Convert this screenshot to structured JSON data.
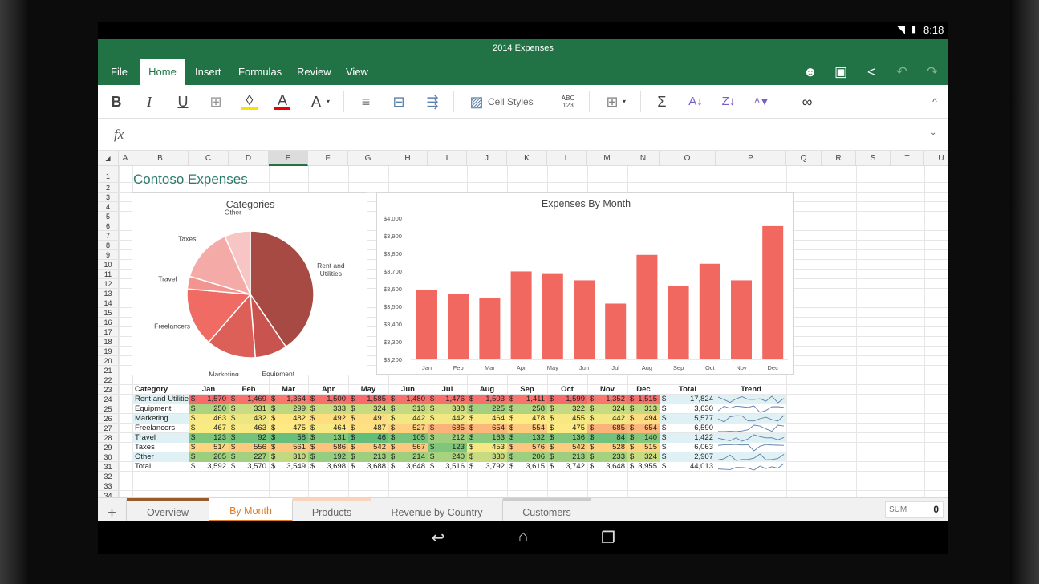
{
  "status": {
    "time": "8:18"
  },
  "title": "2014 Expenses",
  "ribbon_tabs": [
    "File",
    "Home",
    "Insert",
    "Formulas",
    "Review",
    "View"
  ],
  "ribbon_active": "Home",
  "toolbar": {
    "bold": "B",
    "italic": "I",
    "underline": "U",
    "font_color": "A",
    "font_size": "A",
    "cell_styles": "Cell Styles",
    "abc": "ABC",
    "n123": "123",
    "sum": "Σ"
  },
  "formula_bar": {
    "fx": "fx",
    "value": ""
  },
  "columns": [
    "A",
    "B",
    "C",
    "D",
    "E",
    "F",
    "G",
    "H",
    "I",
    "J",
    "K",
    "L",
    "M",
    "N",
    "O",
    "P",
    "Q",
    "R",
    "S",
    "T",
    "U"
  ],
  "selected_column": "E",
  "sheet_title": "Contoso Expenses",
  "table": {
    "header": [
      "Category",
      "Jan",
      "Feb",
      "Mar",
      "Apr",
      "May",
      "Jun",
      "Jul",
      "Aug",
      "Sep",
      "Oct",
      "Nov",
      "Dec",
      "Total",
      "Trend"
    ],
    "currency": "$",
    "rows": [
      {
        "category": "Rent and Utilities",
        "values": [
          1570,
          1469,
          1364,
          1500,
          1585,
          1480,
          1476,
          1503,
          1411,
          1599,
          1352,
          1515
        ],
        "total": 17824
      },
      {
        "category": "Equipment",
        "values": [
          250,
          331,
          299,
          333,
          324,
          313,
          338,
          225,
          258,
          322,
          324,
          313
        ],
        "total": 3630
      },
      {
        "category": "Marketing",
        "values": [
          463,
          432,
          482,
          492,
          491,
          442,
          442,
          464,
          478,
          455,
          442,
          494
        ],
        "total": 5577
      },
      {
        "category": "Freelancers",
        "values": [
          467,
          463,
          475,
          464,
          487,
          527,
          685,
          654,
          554,
          475,
          685,
          654
        ],
        "total": 6590
      },
      {
        "category": "Travel",
        "values": [
          123,
          92,
          58,
          131,
          46,
          105,
          212,
          163,
          132,
          136,
          84,
          140
        ],
        "total": 1422
      },
      {
        "category": "Taxes",
        "values": [
          514,
          556,
          561,
          586,
          542,
          567,
          123,
          453,
          576,
          542,
          528,
          515
        ],
        "total": 6063
      },
      {
        "category": "Other",
        "values": [
          205,
          227,
          310,
          192,
          213,
          214,
          240,
          330,
          206,
          213,
          233,
          324
        ],
        "total": 2907
      }
    ],
    "total_row": {
      "category": "Total",
      "values": [
        3592,
        3570,
        3549,
        3698,
        3688,
        3648,
        3516,
        3792,
        3615,
        3742,
        3648,
        3955
      ],
      "total": 44013
    }
  },
  "heat_colors": {
    "low": "#63be7b",
    "mid": "#ffeb84",
    "high": "#f8696b"
  },
  "chart_data": [
    {
      "type": "pie",
      "title": "Categories",
      "labels": [
        "Rent and Utilities",
        "Equipment",
        "Marketing",
        "Freelancers",
        "Travel",
        "Taxes",
        "Other"
      ],
      "values": [
        17824,
        3630,
        5577,
        6590,
        1422,
        6063,
        2907
      ],
      "colors": [
        "#a84a44",
        "#c9544f",
        "#dc5f58",
        "#ef6b64",
        "#f29590",
        "#f4aaa7",
        "#f7c6c4"
      ]
    },
    {
      "type": "bar",
      "title": "Expenses By Month",
      "categories": [
        "Jan",
        "Feb",
        "Mar",
        "Apr",
        "May",
        "Jun",
        "Jul",
        "Aug",
        "Sep",
        "Oct",
        "Nov",
        "Dec"
      ],
      "values": [
        3592,
        3570,
        3549,
        3698,
        3688,
        3648,
        3516,
        3792,
        3615,
        3742,
        3648,
        3955
      ],
      "ylim": [
        3200,
        4000
      ],
      "yticks": [
        "$4,000",
        "$3,900",
        "$3,800",
        "$3,700",
        "$3,600",
        "$3,500",
        "$3,400",
        "$3,300",
        "$3,200"
      ],
      "color": "#f0685f",
      "xlabel": "",
      "ylabel": ""
    }
  ],
  "sheet_tabs": [
    "Overview",
    "By Month",
    "Products",
    "Revenue by Country",
    "Customers"
  ],
  "sheet_active": "By Month",
  "statusbar": {
    "sum_label": "SUM",
    "sum_value": "0"
  }
}
